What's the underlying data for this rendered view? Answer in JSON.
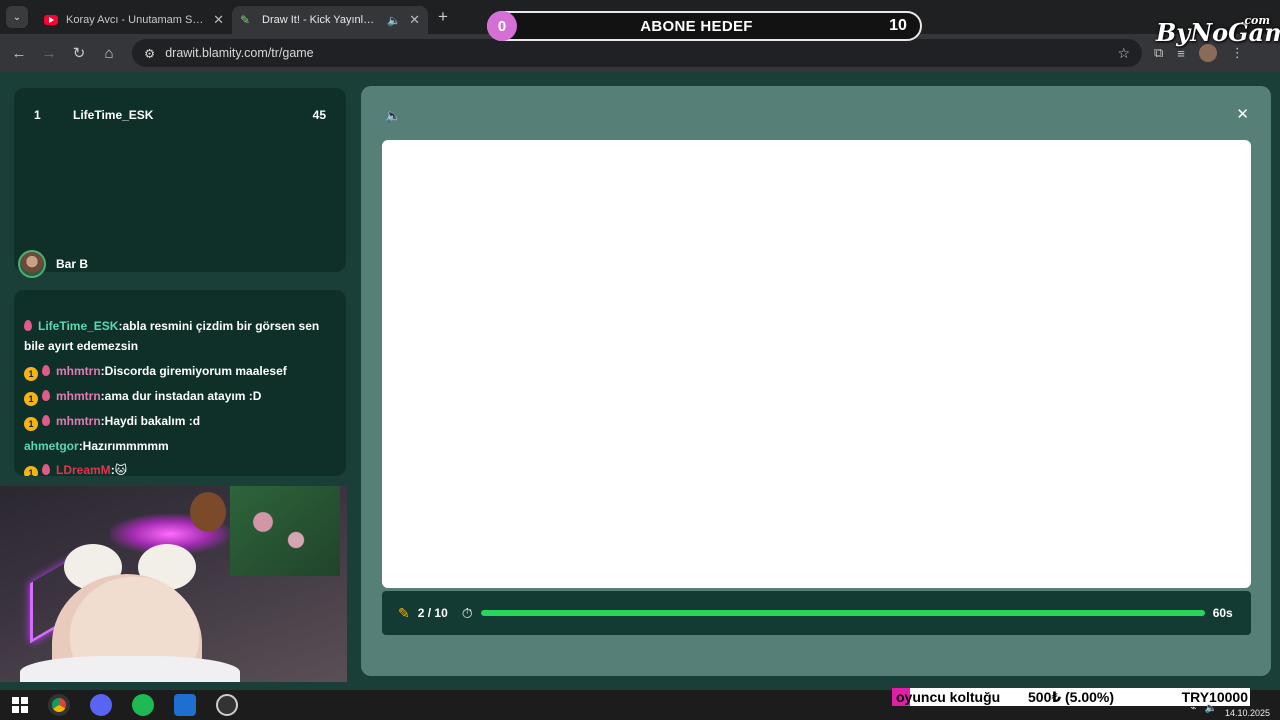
{
  "browser": {
    "tabs": [
      {
        "title": "Koray Avcı - Unutamam Seni (A",
        "icon": "youtube-icon"
      },
      {
        "title": "Draw It! - Kick Yayınları İçin",
        "icon": "pencil-icon",
        "active": true
      }
    ],
    "url": "drawit.blamity.com/tr/game"
  },
  "overlay": {
    "goal_count": "0",
    "goal_title": "ABONE HEDEF",
    "goal_target": "10",
    "brand": "ByNoGame",
    "brand_suffix": ".com"
  },
  "leaderboard": {
    "rows": [
      {
        "rank": "1",
        "name": "LifeTime_ESK",
        "score": "45"
      }
    ],
    "current_drawer": "Bar B"
  },
  "chat": [
    {
      "user": "LifeTime_ESK",
      "text": ":abla resmini çizdim bir görsen sen bile ayırt edemezsin",
      "badges": [
        "drop"
      ],
      "color": "teal"
    },
    {
      "user": "mhmtrn",
      "text": ":Discorda giremiyorum maalesef",
      "badges": [
        "sub",
        "drop"
      ],
      "color": "pink"
    },
    {
      "user": "mhmtrn",
      "text": ":ama dur instadan atayım :D",
      "badges": [
        "sub",
        "drop"
      ],
      "color": "pink"
    },
    {
      "user": "mhmtrn",
      "text": ":Haydi bakalım :d",
      "badges": [
        "sub",
        "drop"
      ],
      "color": "pink"
    },
    {
      "user": "ahmetgor",
      "text": ":Hazırımmmmm",
      "badges": [],
      "color": "teal"
    },
    {
      "user": "LDreamM",
      "text": ":🐱",
      "badges": [
        "sub",
        "drop"
      ],
      "color": "red"
    }
  ],
  "game": {
    "round": "2 / 10",
    "time_left": "60s",
    "progress": 1.0,
    "accent_color": "#27d65a"
  },
  "ticker": {
    "name": "oyuncu koltuğu",
    "amount": "500₺ (5.00%)",
    "goal": "TRY10000"
  },
  "tray": {
    "date": "14.10.2025"
  }
}
